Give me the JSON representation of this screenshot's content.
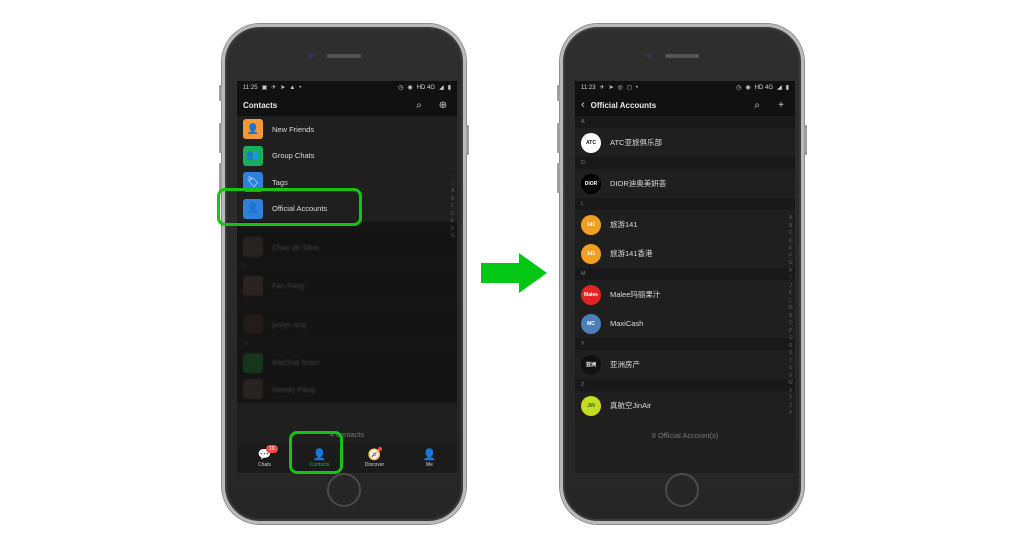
{
  "left_phone": {
    "status": {
      "time": "11:25",
      "right": "HD 4G"
    },
    "header": {
      "title": "Contacts",
      "search_icon": "search-icon",
      "add_icon": "add-circle-icon"
    },
    "menu_items": [
      {
        "label": "New Friends",
        "icon": "new-friends-icon",
        "color": "#f29a38"
      },
      {
        "label": "Group Chats",
        "icon": "group-chats-icon",
        "color": "#1aad5a"
      },
      {
        "label": "Tags",
        "icon": "tag-icon",
        "color": "#2f7fdd"
      },
      {
        "label": "Official Accounts",
        "icon": "official-accounts-icon",
        "color": "#2f7fdd"
      }
    ],
    "contacts": [
      {
        "section": "C",
        "name": "Chan de Silva"
      },
      {
        "section": "F",
        "name": "Fan Fang"
      },
      {
        "section": "J",
        "name": "jaslyn ang"
      },
      {
        "section": "W",
        "name": "WeChat Team"
      },
      {
        "section": "",
        "name": "Wendy Pang"
      }
    ],
    "index_letters": [
      "↑",
      "☆",
      "A",
      "B",
      "C",
      "D",
      "E",
      "F",
      "G"
    ],
    "footer": "4 contacts",
    "tabs": [
      {
        "label": "Chats",
        "icon": "chat-bubble-icon",
        "badge": "10"
      },
      {
        "label": "Contacts",
        "icon": "contacts-icon",
        "active": true
      },
      {
        "label": "Discover",
        "icon": "compass-icon",
        "dot": true
      },
      {
        "label": "Me",
        "icon": "person-icon"
      }
    ]
  },
  "right_phone": {
    "status": {
      "time": "11:23",
      "right": "HD 4G"
    },
    "header": {
      "title": "Official Accounts",
      "back_icon": "back-chevron-icon",
      "search_icon": "search-icon",
      "add_icon": "plus-icon"
    },
    "sections": [
      {
        "letter": "A",
        "items": [
          {
            "name": "ATC亚旅俱乐部",
            "avatar_text": "ATC",
            "avatar_bg": "#ffffff",
            "avatar_fg": "#111111"
          }
        ]
      },
      {
        "letter": "D",
        "items": [
          {
            "name": "DIOR迪奥美妍荟",
            "avatar_text": "DIOR",
            "avatar_bg": "#000000",
            "avatar_fg": "#ffffff"
          }
        ]
      },
      {
        "letter": "L",
        "items": [
          {
            "name": "旅游141",
            "avatar_text": "141",
            "avatar_bg": "#f0a020",
            "avatar_fg": "#ffffff"
          },
          {
            "name": "旅游141香港",
            "avatar_text": "141",
            "avatar_bg": "#f0a020",
            "avatar_fg": "#ffffff"
          }
        ]
      },
      {
        "letter": "M",
        "items": [
          {
            "name": "Malee玛丽果汁",
            "avatar_text": "Malee",
            "avatar_bg": "#e02424",
            "avatar_fg": "#ffffff"
          },
          {
            "name": "MaxiCash",
            "avatar_text": "MC",
            "avatar_bg": "#4a7fb8",
            "avatar_fg": "#ffffff"
          }
        ]
      },
      {
        "letter": "Y",
        "items": [
          {
            "name": "亚洲房产",
            "avatar_text": "亚洲",
            "avatar_bg": "#111111",
            "avatar_fg": "#ffffff"
          }
        ]
      },
      {
        "letter": "Z",
        "items": [
          {
            "name": "真航空JinAir",
            "avatar_text": "JIN",
            "avatar_bg": "#c6dc1e",
            "avatar_fg": "#2a6a2a"
          }
        ]
      }
    ],
    "index_letters": [
      "A",
      "B",
      "C",
      "D",
      "E",
      "F",
      "G",
      "H",
      "I",
      "J",
      "K",
      "L",
      "M",
      "N",
      "O",
      "P",
      "Q",
      "R",
      "S",
      "T",
      "U",
      "V",
      "W",
      "X",
      "Y",
      "Z",
      "#"
    ],
    "footer": "8 Official Account(s)"
  },
  "arrow": {
    "color": "#00c814",
    "icon": "right-arrow-icon"
  },
  "highlight_color": "#16c212"
}
